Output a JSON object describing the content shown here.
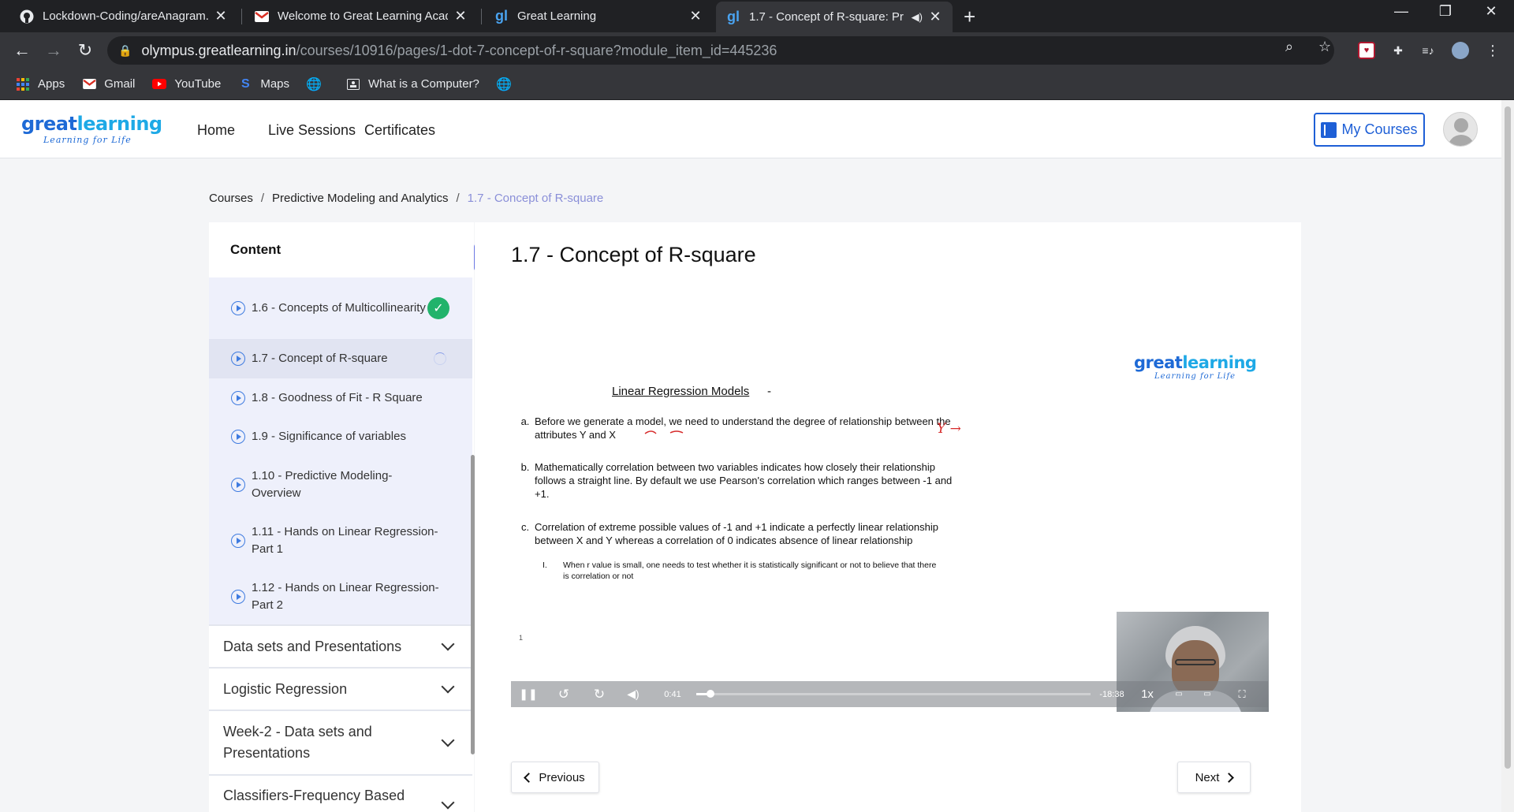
{
  "browser": {
    "tabs": [
      {
        "title": "Lockdown-Coding/areAnagram.j",
        "icon": "github-icon"
      },
      {
        "title": "Welcome to Great Learning Acad",
        "icon": "gmail-icon"
      },
      {
        "title": "Great Learning",
        "icon": "greatlearning-icon"
      },
      {
        "title": "1.7 - Concept of R-square: Pr",
        "icon": "greatlearning-icon"
      }
    ],
    "url_host": "olympus.greatlearning.in",
    "url_path": "/courses/10916/pages/1-dot-7-concept-of-r-square?module_item_id=445236",
    "bookmarks": [
      {
        "label": "Apps",
        "icon": "apps-grid-icon"
      },
      {
        "label": "Gmail",
        "icon": "gmail-icon"
      },
      {
        "label": "YouTube",
        "icon": "youtube-icon"
      },
      {
        "label": "Maps",
        "icon": "maps-icon"
      },
      {
        "label": "",
        "icon": "globe-icon"
      },
      {
        "label": "What is a Computer?",
        "icon": "computer-icon"
      },
      {
        "label": "",
        "icon": "globe-icon"
      }
    ]
  },
  "site": {
    "logo_main_a": "great",
    "logo_main_b": "learning",
    "logo_sub": "Learning for Life",
    "nav": [
      "Home",
      "Live Sessions",
      "Certificates"
    ],
    "my_courses": "My Courses"
  },
  "breadcrumb": {
    "items": [
      "Courses",
      "Predictive Modeling and Analytics",
      "1.7 - Concept of R-square"
    ],
    "sep": "/"
  },
  "sidebar": {
    "title": "Content",
    "lessons": [
      {
        "label": "1.6 - Concepts of Multicollinearity",
        "status": "complete"
      },
      {
        "label": "1.7 - Concept of R-square",
        "status": "current"
      },
      {
        "label": "1.8 - Goodness of Fit - R Square",
        "status": ""
      },
      {
        "label": "1.9 - Significance of variables",
        "status": ""
      },
      {
        "label": "1.10 - Predictive Modeling- Overview",
        "status": ""
      },
      {
        "label": "1.11 - Hands on Linear Regression- Part 1",
        "status": ""
      },
      {
        "label": "1.12 - Hands on Linear Regression- Part 2",
        "status": ""
      }
    ],
    "modules": [
      "Data sets and Presentations",
      "Logistic Regression",
      "Week-2 - Data sets and Presentations",
      "Classifiers-Frequency Based"
    ],
    "collapse_label": "«",
    "check_mark": "✓"
  },
  "main": {
    "title": "1.7 - Concept of R-square",
    "slide": {
      "heading": "Linear Regression Models",
      "heading_dash": "-",
      "items": [
        {
          "marker": "a.",
          "text": "Before we generate a model, we need to understand the degree of relationship between the attributes Y and X"
        },
        {
          "marker": "b.",
          "text": "Mathematically correlation between two variables indicates how closely their relationship follows a straight line. By default we use Pearson's correlation which ranges between -1 and +1."
        },
        {
          "marker": "c.",
          "text": "Correlation of extreme possible values of -1 and +1 indicate a perfectly linear relationship between X and Y whereas a correlation of 0 indicates absence of linear relationship"
        }
      ],
      "subitem": {
        "marker": "I.",
        "text": "When r value is small, one needs to test whether it is statistically significant or not to believe that there is correlation or not"
      },
      "handwriting": "Y →",
      "page_number": "1"
    },
    "player": {
      "elapsed": "0:41",
      "remaining": "-18:38",
      "speed": "1x",
      "progress_fraction": 0.036
    },
    "prev_label": "Previous",
    "next_label": "Next"
  }
}
